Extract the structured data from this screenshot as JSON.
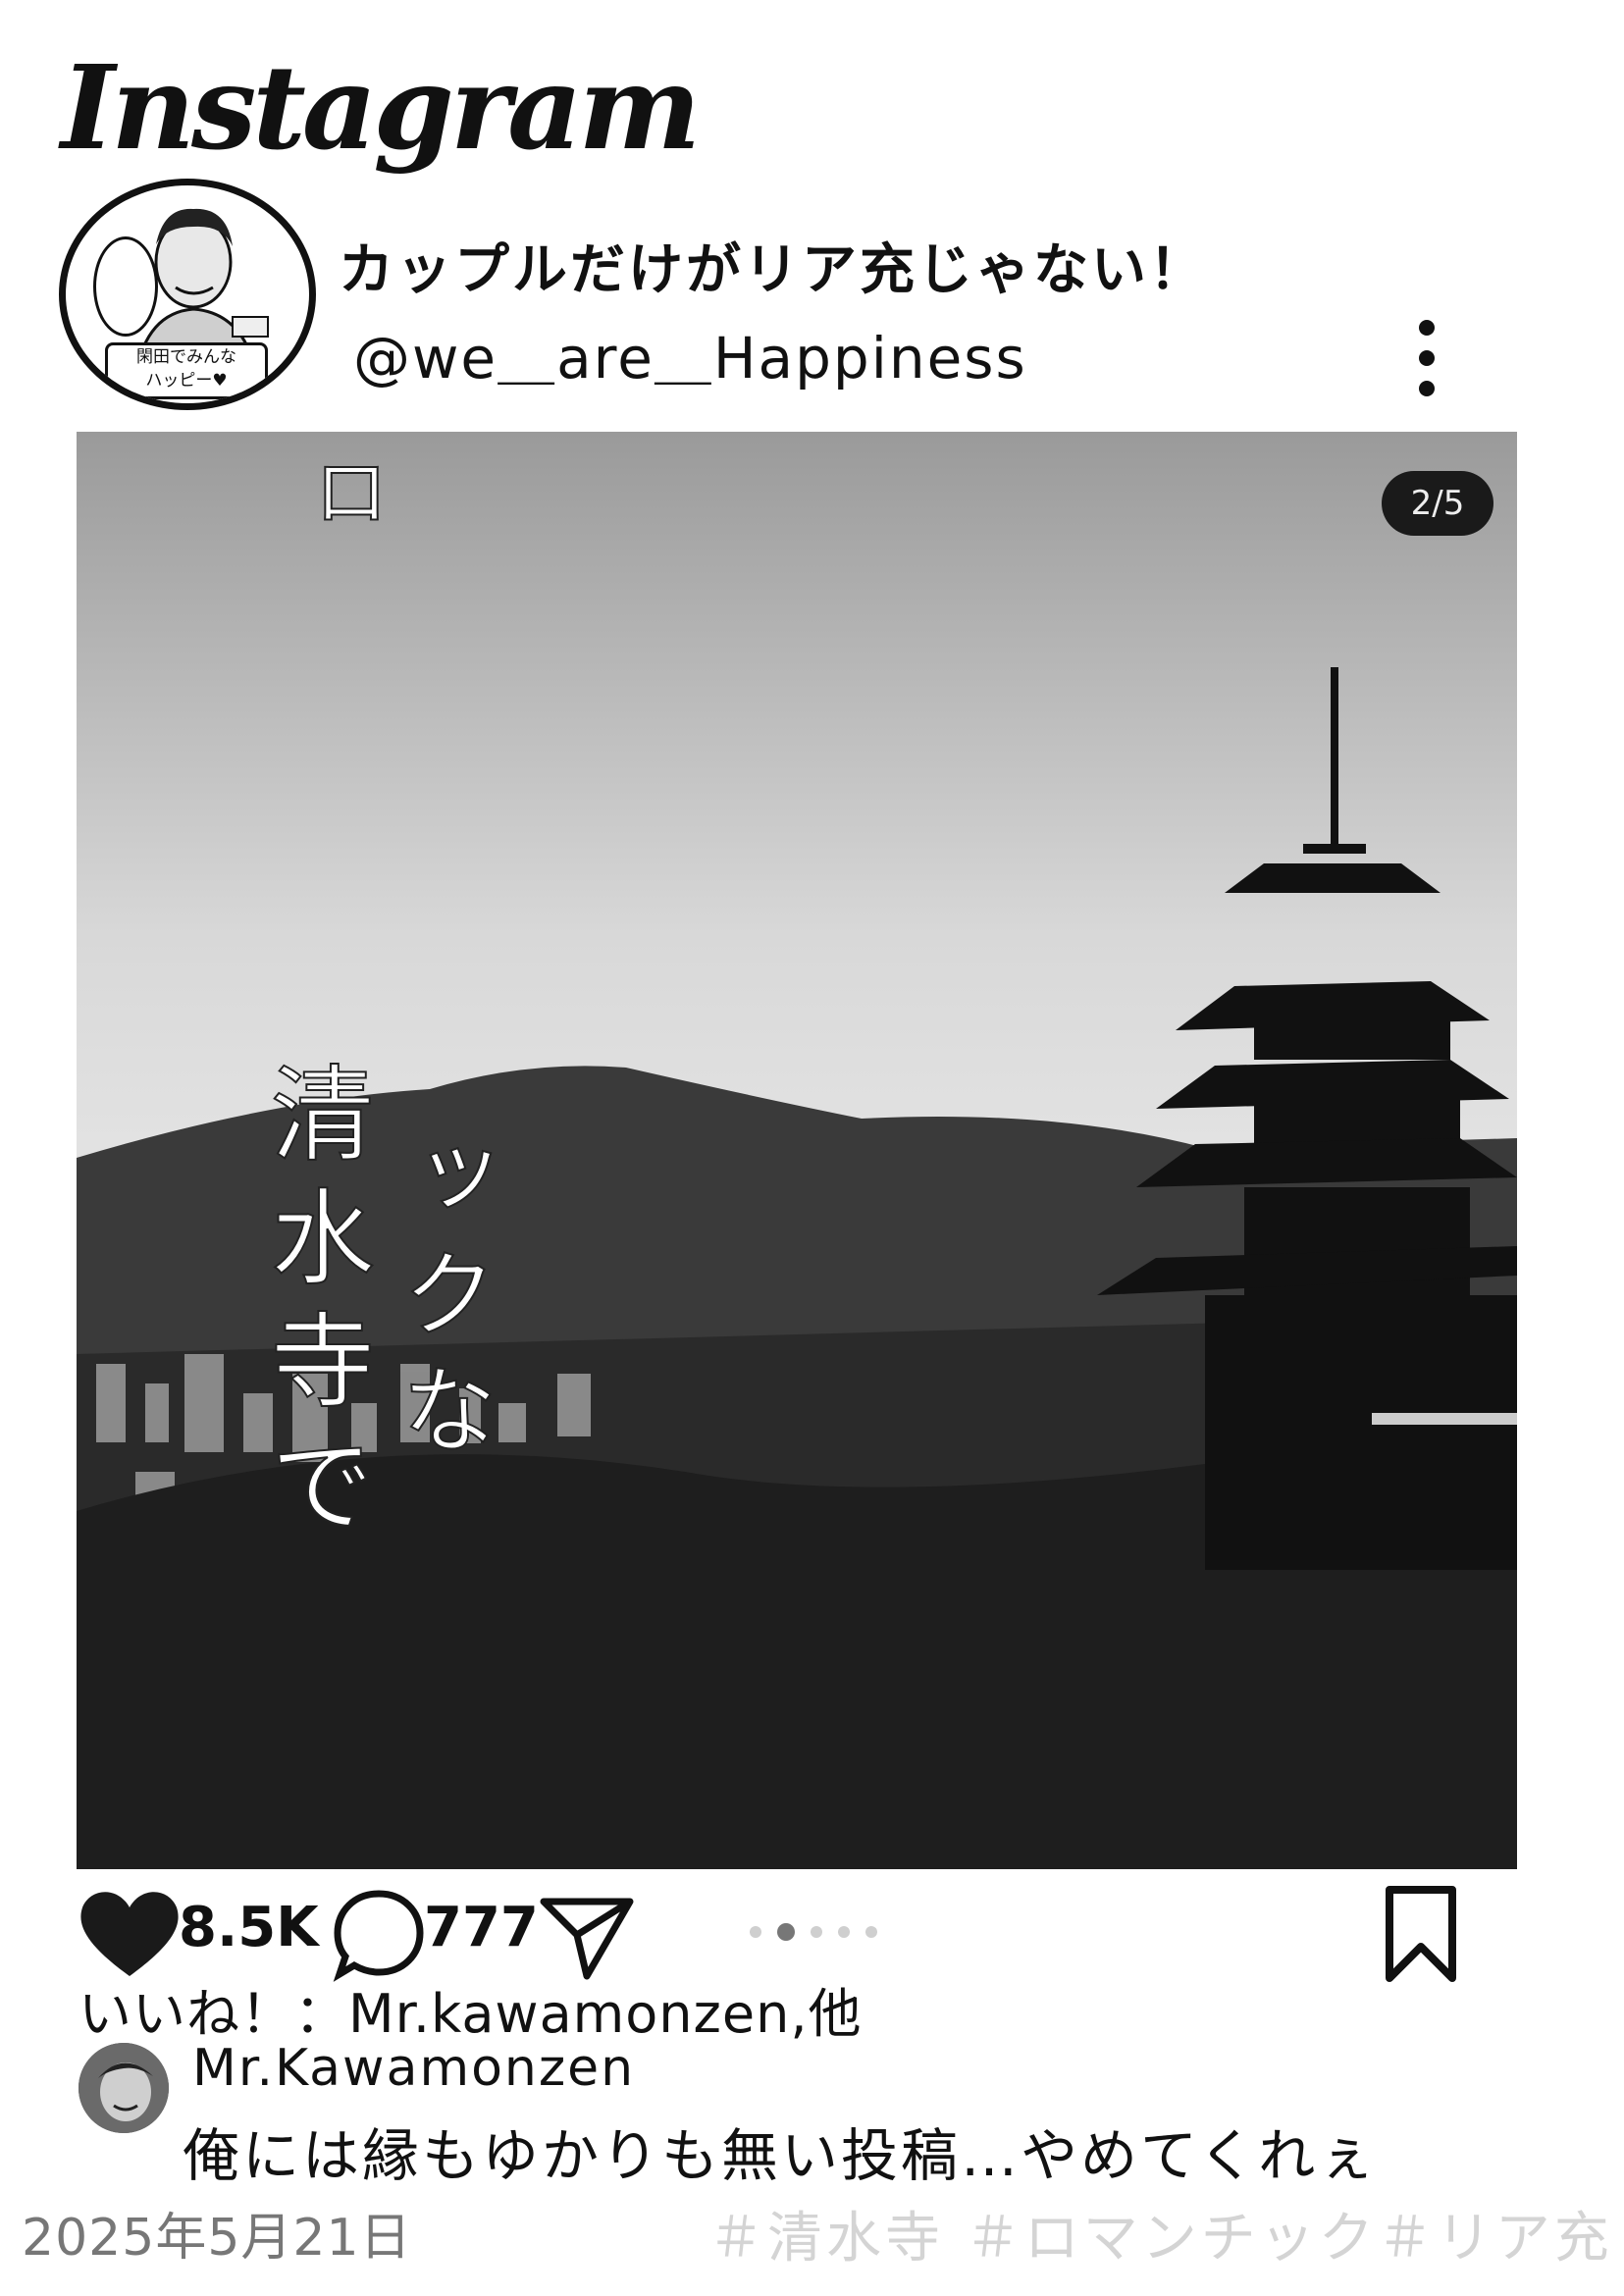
{
  "app": {
    "logo": "Instagram"
  },
  "profile": {
    "title": "カップルだけがリア充じゃない！",
    "handle": "@we＿are＿Happiness",
    "avatar_text_line1": "閑田でみんな",
    "avatar_text_line2": "ハッピー♥"
  },
  "post": {
    "image_counter": "2/5",
    "overlay_text": {
      "col_a": "ックな",
      "col_b": "清水寺で",
      "col_c": "ロ"
    },
    "carousel": {
      "count": 5,
      "active_index": 1
    },
    "likes_count": "8.5K",
    "comments_count": "777",
    "liked_by": "いいね！：Mr.kawamonzen,他",
    "comment": {
      "author": "Mr.Kawamonzen",
      "text": "俺には縁もゆかりも無い投稿…やめてくれぇ"
    },
    "date": "2025年5月21日",
    "hashtags": "＃清水寺 ＃ロマンチック＃リア充"
  },
  "icons": {
    "like": "heart-icon",
    "comment": "comment-bubble-icon",
    "share": "paper-plane-icon",
    "save": "bookmark-icon",
    "more": "more-vertical-icon"
  }
}
